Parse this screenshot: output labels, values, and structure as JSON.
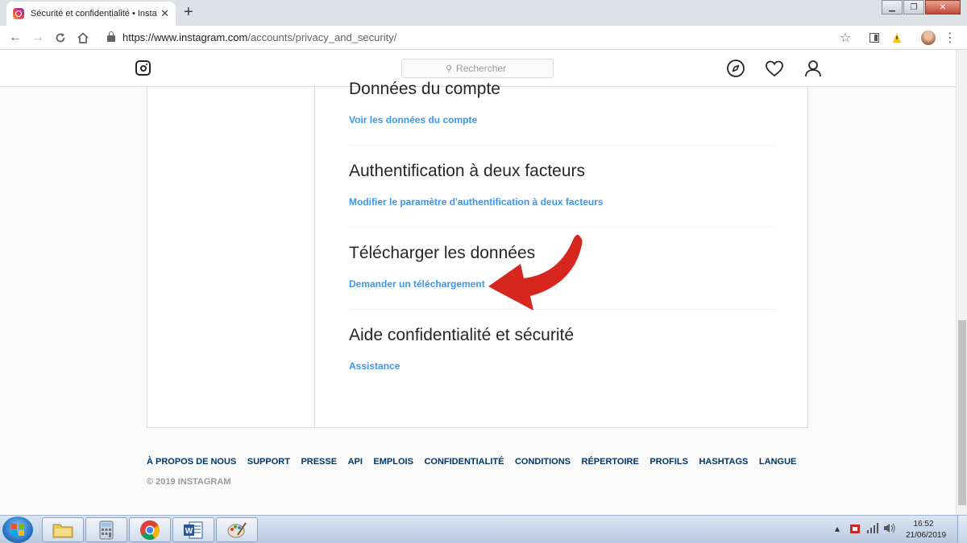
{
  "browser": {
    "tab_title": "Sécurité et confidentialité • Insta",
    "url_host": "https://www.instagram.com",
    "url_path": "/accounts/privacy_and_security/"
  },
  "header": {
    "search_placeholder": "Rechercher"
  },
  "sections": [
    {
      "title": "Données du compte",
      "link": "Voir les données du compte"
    },
    {
      "title": "Authentification à deux facteurs",
      "link": "Modifier le paramètre d'authentification à deux facteurs"
    },
    {
      "title": "Télécharger les données",
      "link": "Demander un téléchargement"
    },
    {
      "title": "Aide confidentialité et sécurité",
      "link": "Assistance"
    }
  ],
  "footer": {
    "links": [
      "À PROPOS DE NOUS",
      "SUPPORT",
      "PRESSE",
      "API",
      "EMPLOIS",
      "CONFIDENTIALITÉ",
      "CONDITIONS",
      "RÉPERTOIRE",
      "PROFILS",
      "HASHTAGS",
      "LANGUE"
    ],
    "copyright": "© 2019 INSTAGRAM"
  },
  "taskbar": {
    "time": "16:52",
    "date": "21/06/2019",
    "apps": [
      "file-explorer-icon",
      "calculator-icon",
      "chrome-icon",
      "word-icon",
      "paint-icon"
    ]
  },
  "colors": {
    "link": "#3897f0",
    "footer_link": "#003569",
    "annotation_arrow": "#d7261e"
  }
}
